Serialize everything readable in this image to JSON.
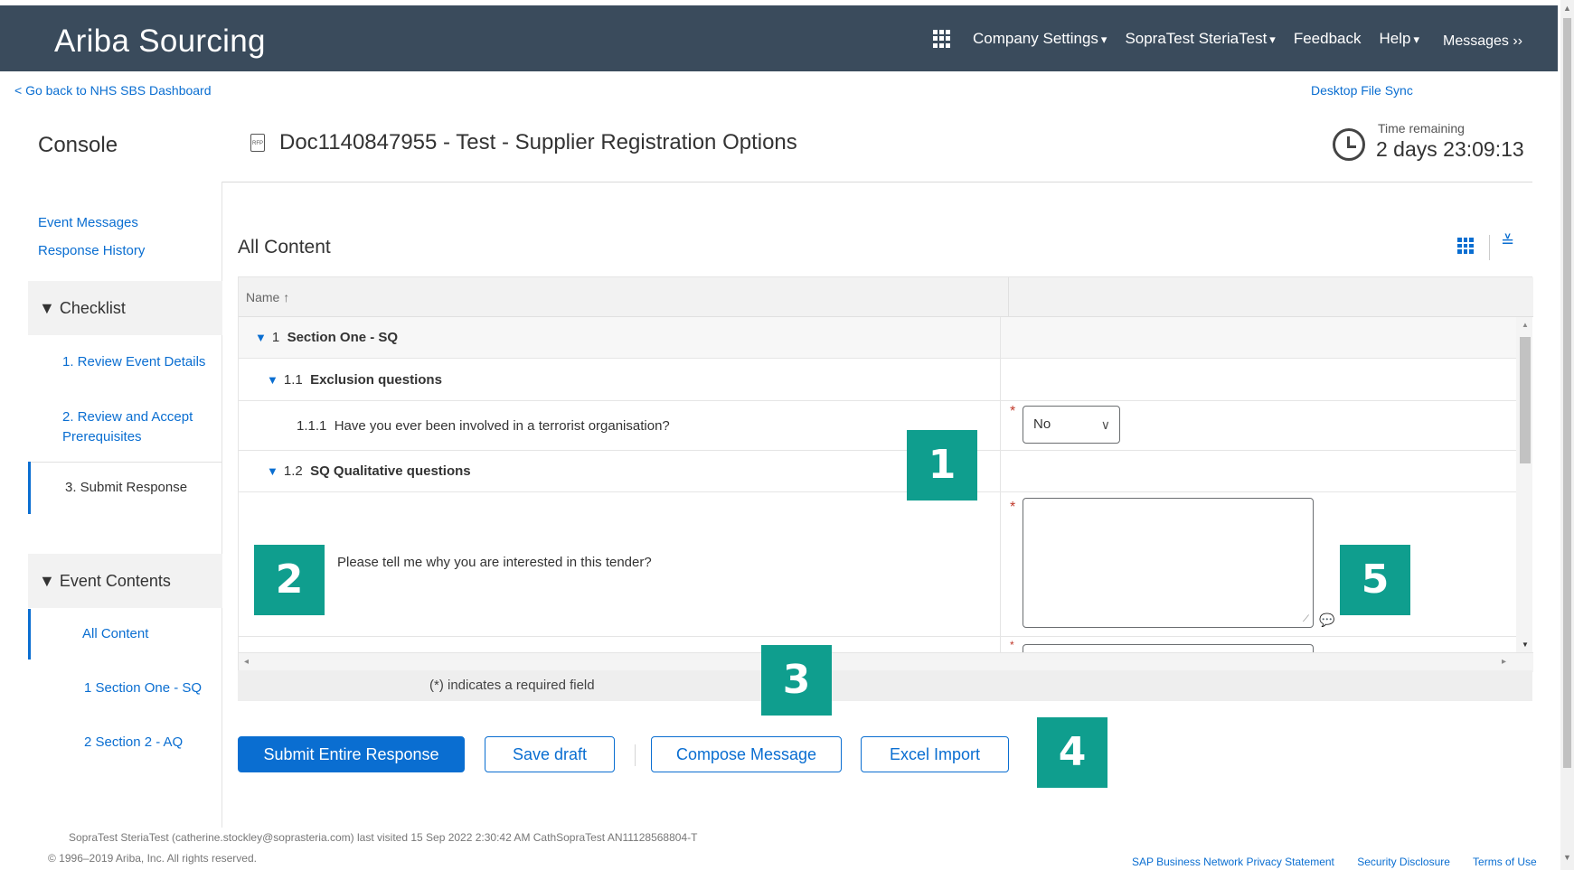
{
  "header": {
    "brand": "Ariba Sourcing",
    "nav": [
      {
        "label": "Company Settings",
        "caret": "▾"
      },
      {
        "label": "SopraTest SteriaTest",
        "caret": "▾"
      },
      {
        "label": "Feedback",
        "caret": ""
      },
      {
        "label": "Help",
        "caret": "▾"
      }
    ],
    "messages": "Messages ››"
  },
  "top_links": {
    "back": "< Go back to NHS SBS Dashboard",
    "file_sync": "Desktop File Sync"
  },
  "page": {
    "console_title": "Console",
    "doc_title": "Doc1140847955 - Test - Supplier Registration Options",
    "doc_icon_text": "RFP",
    "time_label": "Time remaining",
    "time_value": "2 days 23:09:13"
  },
  "sidebar": {
    "event_messages": "Event Messages",
    "response_history": "Response History",
    "checklist_label": "▼ Checklist",
    "checklist": [
      {
        "label": "1.  Review Event Details"
      },
      {
        "label": "2.  Review and Accept Prerequisites"
      },
      {
        "label": "3.  Submit Response"
      }
    ],
    "event_contents_label": "▼ Event Contents",
    "all_content": "All Content",
    "sections": [
      {
        "label": "1  Section One - SQ"
      },
      {
        "label": "2  Section 2 - AQ"
      }
    ]
  },
  "main": {
    "title": "All Content",
    "column_name": "Name ↑",
    "rows": {
      "s1_num": "1",
      "s1_label": "Section One - SQ",
      "s11_num": "1.1",
      "s11_label": "Exclusion questions",
      "q111_num": "1.1.1",
      "q111_label": "Have you ever been involved in a terrorist organisation?",
      "q111_value": "No",
      "s12_num": "1.2",
      "s12_label": "SQ Qualitative questions",
      "q_interest": "Please tell me why you are interested in this tender?"
    },
    "required_mark": "*",
    "required_note": "(*) indicates a required field"
  },
  "buttons": {
    "submit": "Submit Entire Response",
    "save_draft": "Save draft",
    "compose": "Compose Message",
    "excel": "Excel Import"
  },
  "callouts": [
    "1",
    "2",
    "3",
    "4",
    "5"
  ],
  "footer": {
    "visited": "SopraTest SteriaTest (catherine.stockley@soprasteria.com) last visited 15 Sep 2022 2:30:42 AM  CathSopraTest  AN11128568804-T",
    "copyright": "© 1996–2019 Ariba, Inc. All rights reserved.",
    "links": [
      "SAP Business Network Privacy Statement",
      "Security Disclosure",
      "Terms of Use"
    ]
  },
  "colors": {
    "header_bg": "#3a4b5c",
    "accent": "#0a6ed1",
    "callout": "#0f9e8e"
  }
}
